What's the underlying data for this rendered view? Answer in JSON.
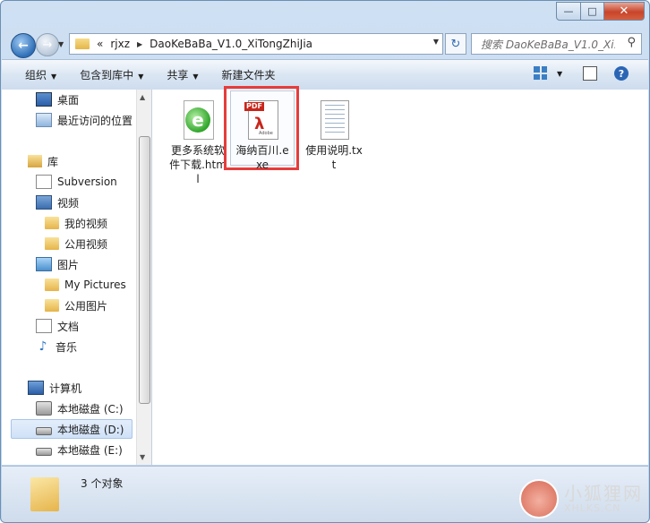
{
  "address": {
    "overflow": "«",
    "crumbs": [
      "rjxz",
      "DaoKeBaBa_V1.0_XiTongZhiJia"
    ]
  },
  "search": {
    "placeholder": "搜索 DaoKeBaBa_V1.0_Xi..."
  },
  "toolbar": {
    "organize": "组织",
    "include_library": "包含到库中",
    "share": "共享",
    "new_folder": "新建文件夹"
  },
  "nav": {
    "desktop": "桌面",
    "recent": "最近访问的位置",
    "libraries": "库",
    "subversion": "Subversion",
    "videos": "视频",
    "my_videos": "我的视频",
    "public_videos": "公用视频",
    "pictures": "图片",
    "my_pictures": "My Pictures",
    "public_pictures": "公用图片",
    "documents": "文档",
    "music": "音乐",
    "computer": "计算机",
    "drive_c": "本地磁盘 (C:)",
    "drive_d": "本地磁盘 (D:)",
    "drive_e": "本地磁盘 (E:)"
  },
  "files": [
    {
      "name": "更多系统软件下载.html",
      "icon": "ie-html-icon"
    },
    {
      "name": "海纳百川.exe",
      "icon": "pdf-icon"
    },
    {
      "name": "使用说明.txt",
      "icon": "text-file-icon"
    }
  ],
  "status": {
    "count": "3 个对象"
  },
  "watermark": {
    "cn": "小狐狸网",
    "en": "XHLKS.CN"
  },
  "colors": {
    "highlight": "#e63c3c",
    "accent": "#2b66b5"
  }
}
